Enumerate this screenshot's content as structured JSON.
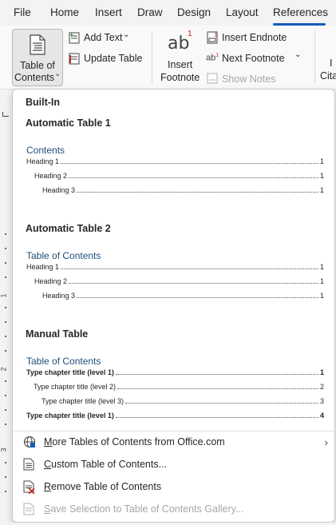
{
  "tabs": [
    "File",
    "Home",
    "Insert",
    "Draw",
    "Design",
    "Layout",
    "References"
  ],
  "active_tab": "References",
  "ribbon": {
    "toc_line1": "Table of",
    "toc_line2": "Contents",
    "toc_caret": "⌄",
    "add_text": "Add Text",
    "add_text_caret": "⌄",
    "update_table": "Update Table",
    "insert_footnote_line1": "Insert",
    "insert_footnote_line2": "Footnote",
    "footnote_glyph": "ab",
    "footnote_sup": "1",
    "insert_endnote": "Insert Endnote",
    "next_footnote": "Next Footnote",
    "next_footnote_caret": "⌄",
    "show_notes": "Show Notes",
    "cut_label_1": "I",
    "cut_label_2": "Cita"
  },
  "ruler": {
    "numbers": [
      "1",
      "2",
      "3"
    ]
  },
  "menu": {
    "builtin_heading": "Built-In",
    "galleries": [
      {
        "name": "Automatic Table 1",
        "title": "Contents",
        "lines": [
          {
            "text": "Heading 1",
            "page": "1"
          },
          {
            "text": "Heading 2",
            "page": "1"
          },
          {
            "text": "Heading 3",
            "page": "1"
          }
        ]
      },
      {
        "name": "Automatic Table 2",
        "title": "Table of Contents",
        "lines": [
          {
            "text": "Heading 1",
            "page": "1"
          },
          {
            "text": "Heading 2",
            "page": "1"
          },
          {
            "text": "Heading 3",
            "page": "1"
          }
        ]
      },
      {
        "name": "Manual Table",
        "title": "Table of Contents",
        "lines": [
          {
            "text": "Type chapter title (level 1)",
            "page": "1"
          },
          {
            "text": "Type chapter title (level 2)",
            "page": "2"
          },
          {
            "text": "Type chapter title (level 3)",
            "page": "3"
          },
          {
            "text": "Type chapter title (level 1)",
            "page": "4"
          }
        ]
      }
    ],
    "commands": [
      {
        "label_u": "M",
        "label_rest": "ore Tables of Contents from Office.com",
        "icon": "globe-icon",
        "arrow": "›",
        "enabled": true
      },
      {
        "label_u": "C",
        "label_rest": "ustom Table of Contents...",
        "icon": "toc-document-icon",
        "enabled": true
      },
      {
        "label_u": "R",
        "label_rest": "emove Table of Contents",
        "icon": "remove-toc-icon",
        "enabled": true
      },
      {
        "label_u": "S",
        "label_rest": "ave Selection to Table of Contents Gallery...",
        "icon": "save-selection-icon",
        "enabled": false
      }
    ]
  },
  "colors": {
    "accent": "#185abd",
    "toc_title": "#1f4e79",
    "remove_red": "#c42b1c"
  }
}
